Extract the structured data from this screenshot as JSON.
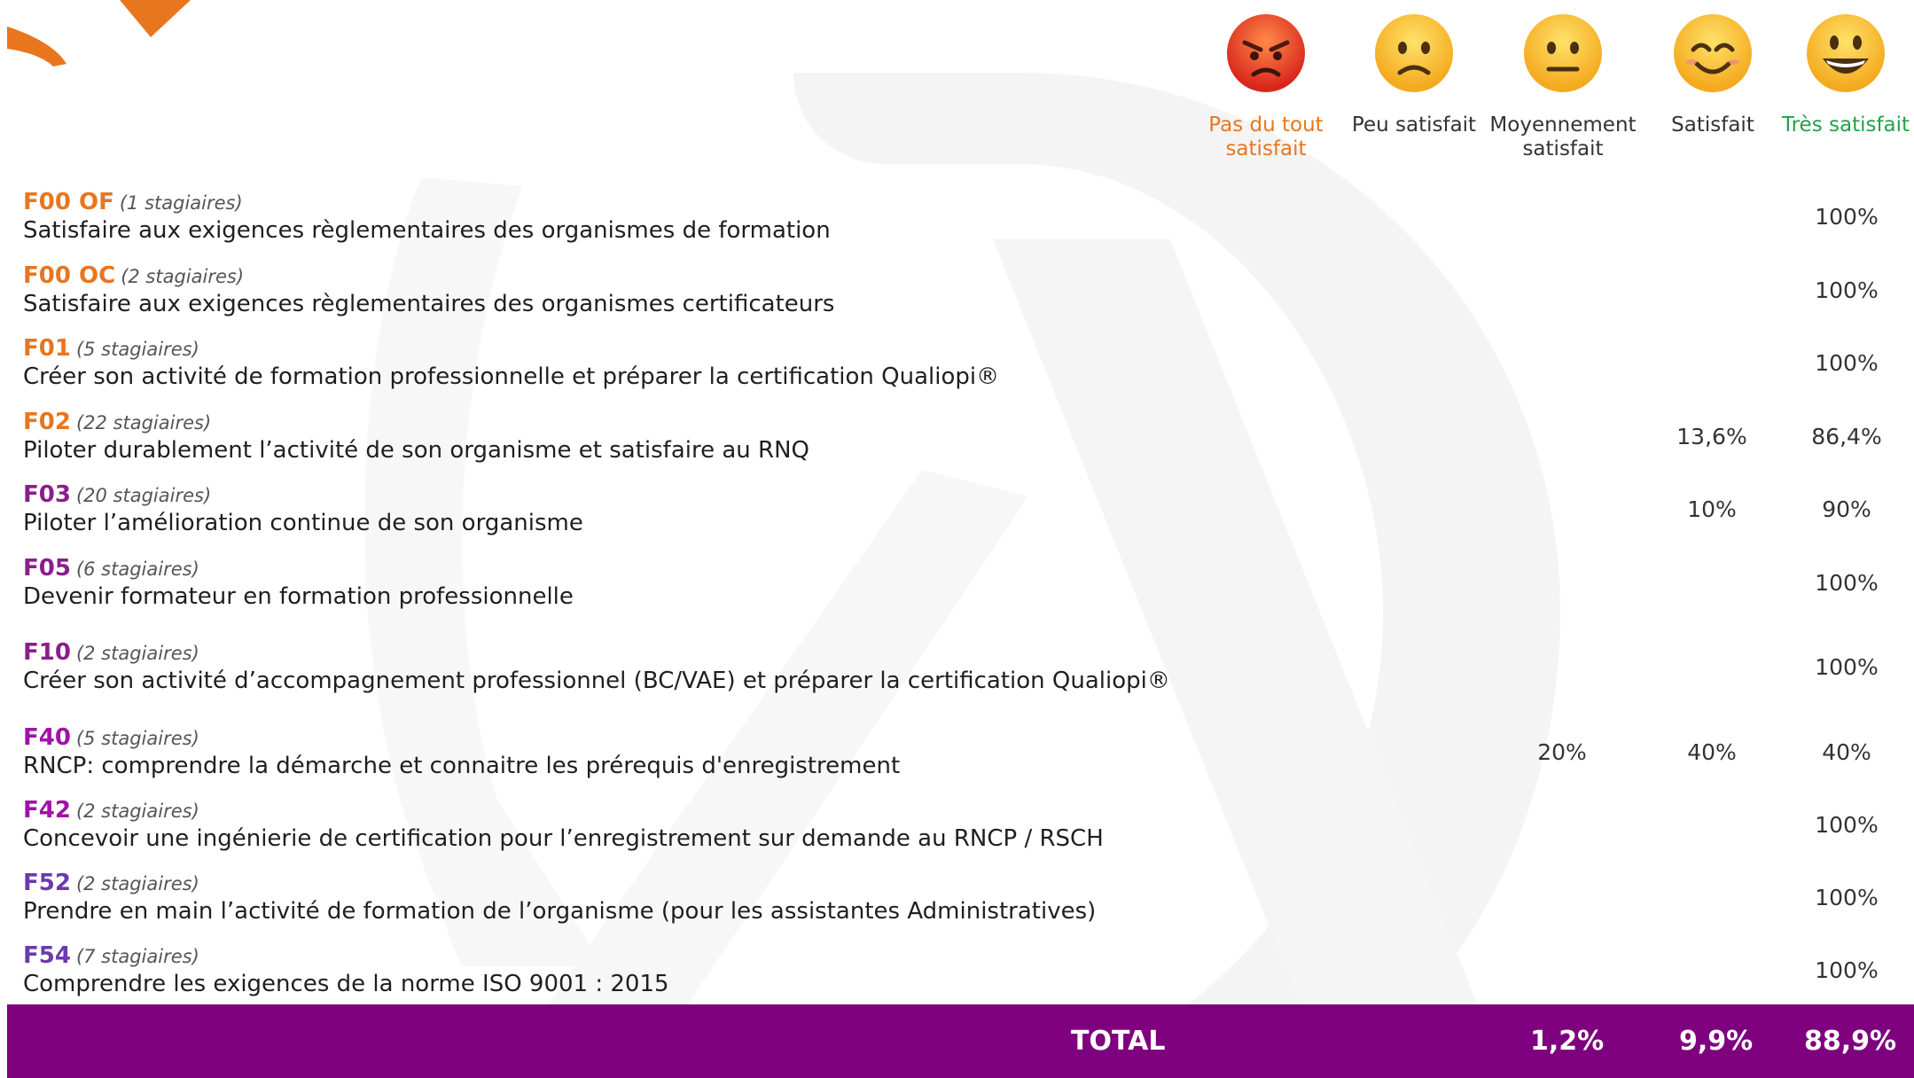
{
  "colors": {
    "orange": "#e8761f",
    "purple_dark": "#8a1f8a",
    "purple_mid": "#a012a8",
    "purple_blue": "#6a3ab0",
    "green": "#22a24a",
    "total_bg": "#7e007e",
    "watermark": "#f4f4f4"
  },
  "header": {
    "emojis": [
      "angry-face-icon",
      "frowning-face-icon",
      "neutral-face-icon",
      "smiling-face-icon",
      "grinning-face-icon"
    ],
    "col1": "Pas du tout satisfait",
    "col2": "Peu satisfait",
    "col3": "Moyennement satisfait",
    "col4": "Satisfait",
    "col5": "Très satisfait"
  },
  "rows": [
    {
      "code": "F00 OF",
      "count": "(1 stagiaires)",
      "title": "Satisfaire aux exigences règlementaires des organismes de formation",
      "v3": "",
      "v4": "",
      "v5": "100%"
    },
    {
      "code": "F00 OC",
      "count": "(2 stagiaires)",
      "title": "Satisfaire aux exigences règlementaires des organismes certificateurs",
      "v3": "",
      "v4": "",
      "v5": "100%"
    },
    {
      "code": "F01",
      "count": "(5 stagiaires)",
      "title": "Créer son activité de formation professionnelle et préparer la certification Qualiopi®",
      "v3": "",
      "v4": "",
      "v5": "100%"
    },
    {
      "code": "F02",
      "count": "(22 stagiaires)",
      "title": "Piloter durablement l’activité de son organisme et satisfaire au RNQ",
      "v3": "",
      "v4": "13,6%",
      "v5": "86,4%"
    },
    {
      "code": "F03",
      "count": "(20 stagiaires)",
      "title": "Piloter l’amélioration continue de son organisme",
      "v3": "",
      "v4": "10%",
      "v5": "90%"
    },
    {
      "code": "F05",
      "count": "(6 stagiaires)",
      "title": "Devenir formateur en formation professionnelle",
      "v3": "",
      "v4": "",
      "v5": "100%"
    },
    {
      "code": "F10",
      "count": "(2 stagiaires)",
      "title": "Créer son activité d’accompagnement professionnel (BC/VAE) et préparer la certification Qualiopi®",
      "v3": "",
      "v4": "",
      "v5": "100%"
    },
    {
      "code": "F40",
      "count": "(5 stagiaires)",
      "title": "RNCP: comprendre la démarche et connaitre les prérequis d'enregistrement",
      "v3": "20%",
      "v4": "40%",
      "v5": "40%"
    },
    {
      "code": "F42",
      "count": "(2 stagiaires)",
      "title": "Concevoir une ingénierie de certification pour l’enregistrement sur demande au RNCP / RSCH",
      "v3": "",
      "v4": "",
      "v5": "100%"
    },
    {
      "code": "F52",
      "count": "(2 stagiaires)",
      "title": "Prendre en main l’activité de formation de l’organisme (pour les assistantes Administratives)",
      "v3": "",
      "v4": "",
      "v5": "100%"
    },
    {
      "code": "F54",
      "count": "(7 stagiaires)",
      "title": "Comprendre les exigences de la norme ISO 9001 : 2015",
      "v3": "",
      "v4": "",
      "v5": "100%"
    }
  ],
  "total": {
    "label": "TOTAL",
    "v3": "1,2%",
    "v4": "9,9%",
    "v5": "88,9%"
  }
}
